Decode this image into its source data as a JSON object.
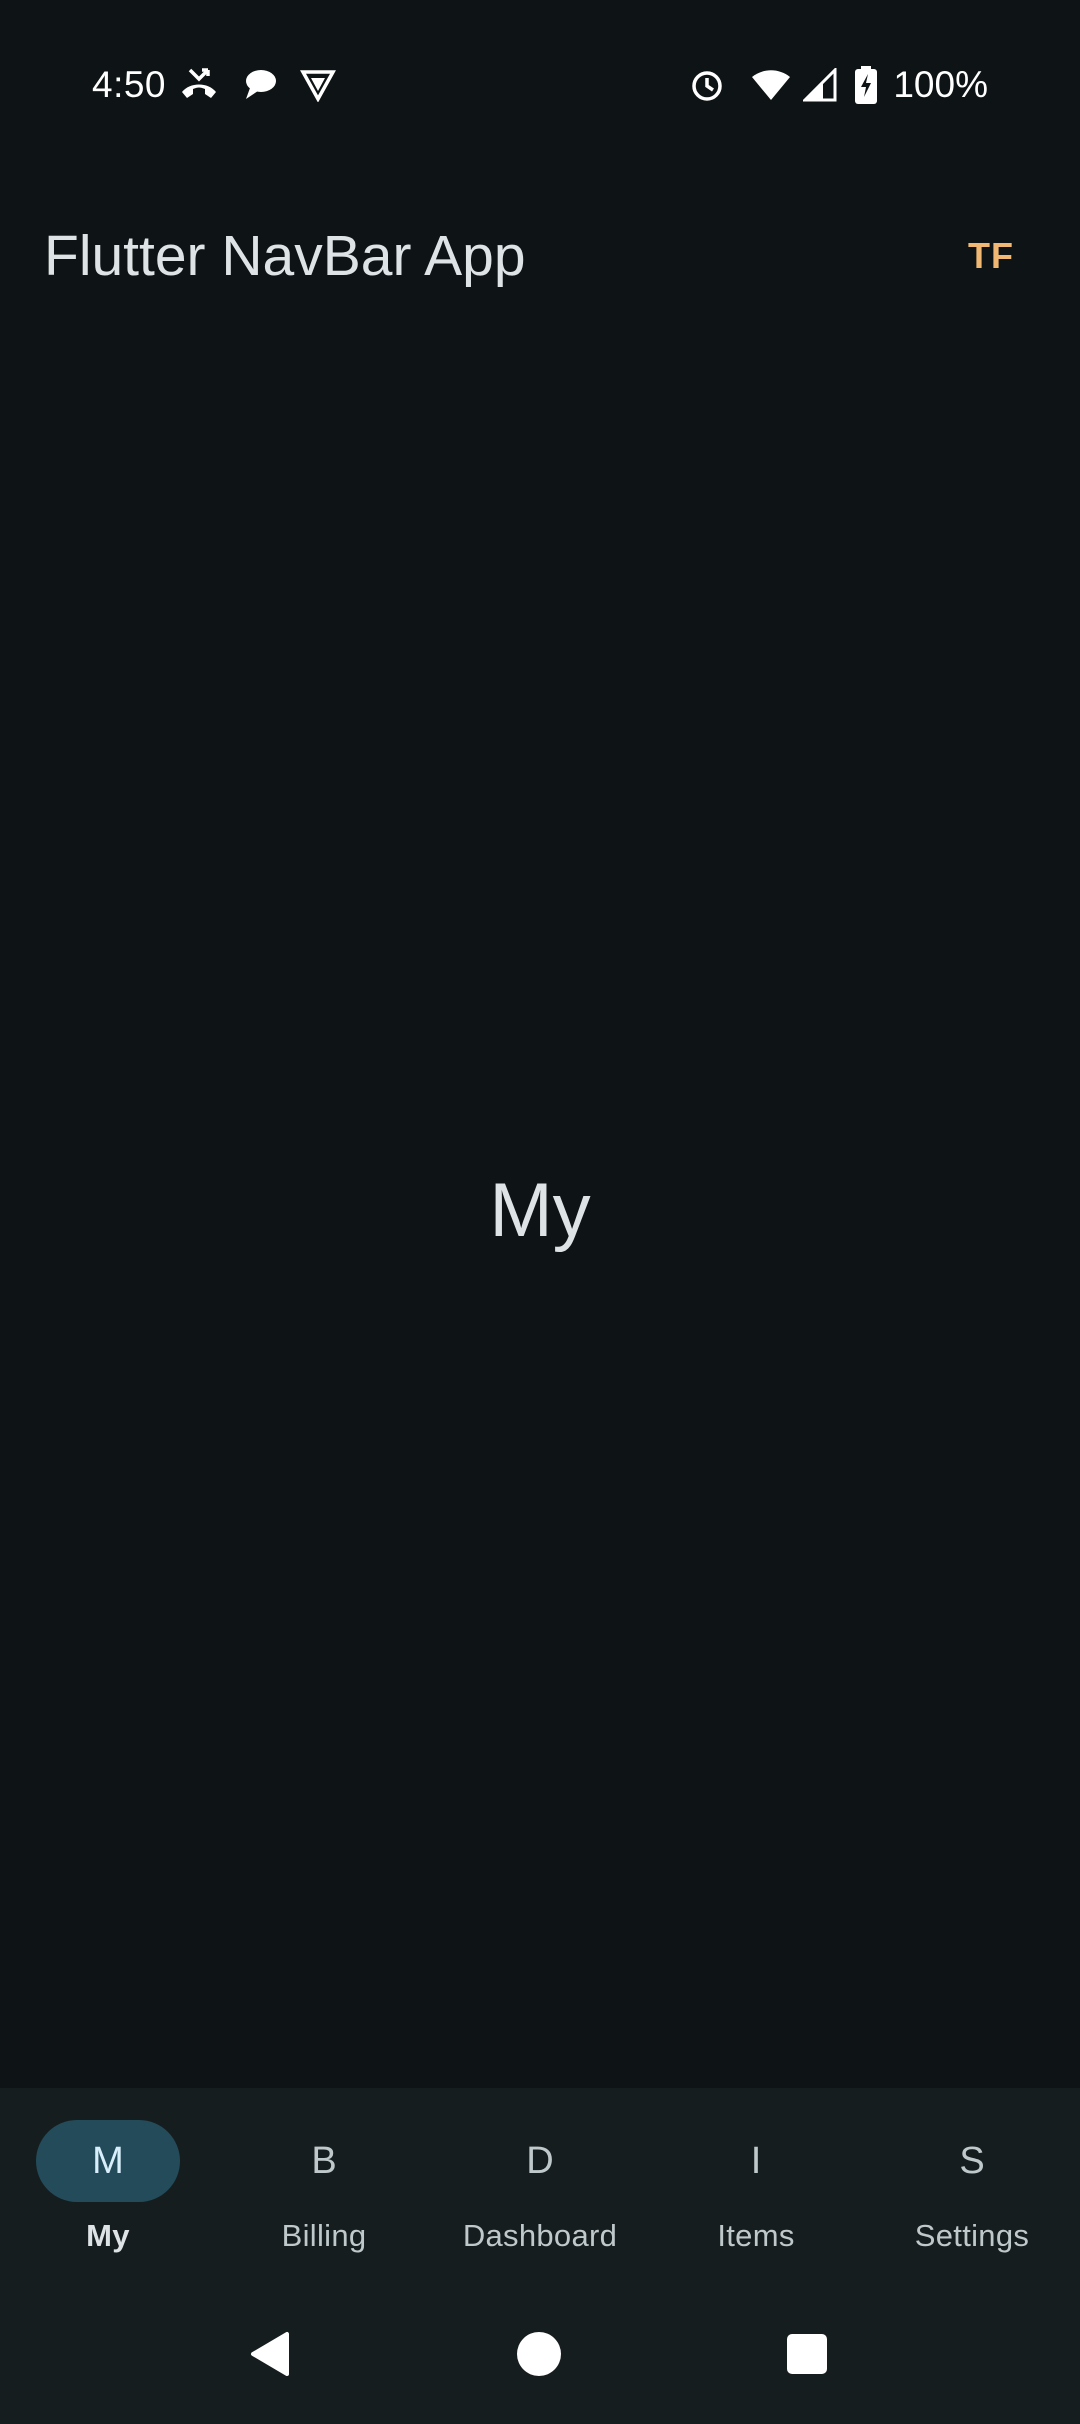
{
  "status_bar": {
    "time": "4:50",
    "left_icons": [
      "missed-call-icon",
      "chat-bubble-icon",
      "vpn-shield-icon"
    ],
    "right_icons": [
      "alarm-clock-icon",
      "wifi-icon",
      "cell-signal-icon",
      "battery-charging-icon"
    ],
    "battery": "100%"
  },
  "app_bar": {
    "title": "Flutter NavBar App",
    "avatar_initials": "TF"
  },
  "body": {
    "page_label": "My"
  },
  "bottom_nav": {
    "items": [
      {
        "icon": "M",
        "label": "My",
        "selected": true
      },
      {
        "icon": "B",
        "label": "Billing",
        "selected": false
      },
      {
        "icon": "D",
        "label": "Dashboard",
        "selected": false
      },
      {
        "icon": "I",
        "label": "Items",
        "selected": false
      },
      {
        "icon": "S",
        "label": "Settings",
        "selected": false
      }
    ]
  },
  "system_nav": {
    "buttons": [
      "back-icon",
      "home-icon",
      "recents-icon"
    ]
  },
  "colors": {
    "background": "#0e1415",
    "nav_background": "#161d1f",
    "selected_indicator": "#234b5a",
    "avatar_text": "#f0b872",
    "text_primary": "#dee3e5",
    "text_secondary": "#bfc8cb"
  }
}
